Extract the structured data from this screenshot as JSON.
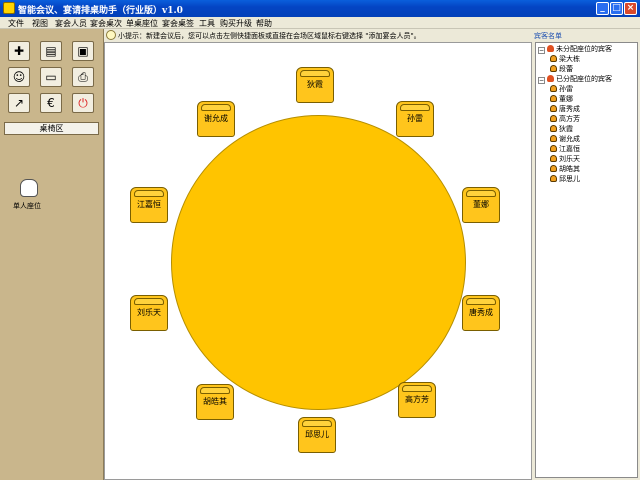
{
  "window": {
    "title": "智能会议、宴请排桌助手（行业版）v1.0",
    "buttons": {
      "minimize": "_",
      "maximize": "□",
      "close": "×"
    }
  },
  "menu": [
    "文件",
    "视图",
    "宴会人员",
    "宴会桌次",
    "单桌座位",
    "宴会桌签",
    "工具",
    "购买升级",
    "帮助"
  ],
  "toolbar": {
    "icons": [
      "new-doc-icon",
      "open-folder-icon",
      "save-icon",
      "add-person-icon",
      "id-card-icon",
      "print-icon",
      "export-icon",
      "money-icon",
      "power-icon"
    ]
  },
  "left_panel": {
    "section_title": "桌椅区",
    "single_seat_label": "单人座位"
  },
  "hint": {
    "text": "小提示：新建会议后，您可以点击左侧快捷面板或直接在会场区域鼠标右键选择 \"添加宴会人员\"。"
  },
  "table": {
    "seats": [
      "狄霞",
      "孙雷",
      "董娜",
      "唐秀成",
      "高方芳",
      "邱思儿",
      "胡皓其",
      "刘乐天",
      "江嘉恒",
      "谢允成"
    ]
  },
  "right_panel": {
    "header": "宾客名单",
    "tree": {
      "unassigned_label": "未分配座位的宾客",
      "unassigned": [
        "梁大栋",
        "段蕾"
      ],
      "assigned_label": "已分配座位的宾客",
      "assigned": [
        "孙雷",
        "董娜",
        "唐秀成",
        "高方芳",
        "狄霞",
        "谢允成",
        "江嘉恒",
        "刘乐天",
        "胡皓其",
        "邱思儿"
      ]
    }
  },
  "colors": {
    "table": "#ffc400",
    "chair": "#ffc51c",
    "left_panel": "#c9b68c",
    "title_bar": "#0a5fdc"
  }
}
